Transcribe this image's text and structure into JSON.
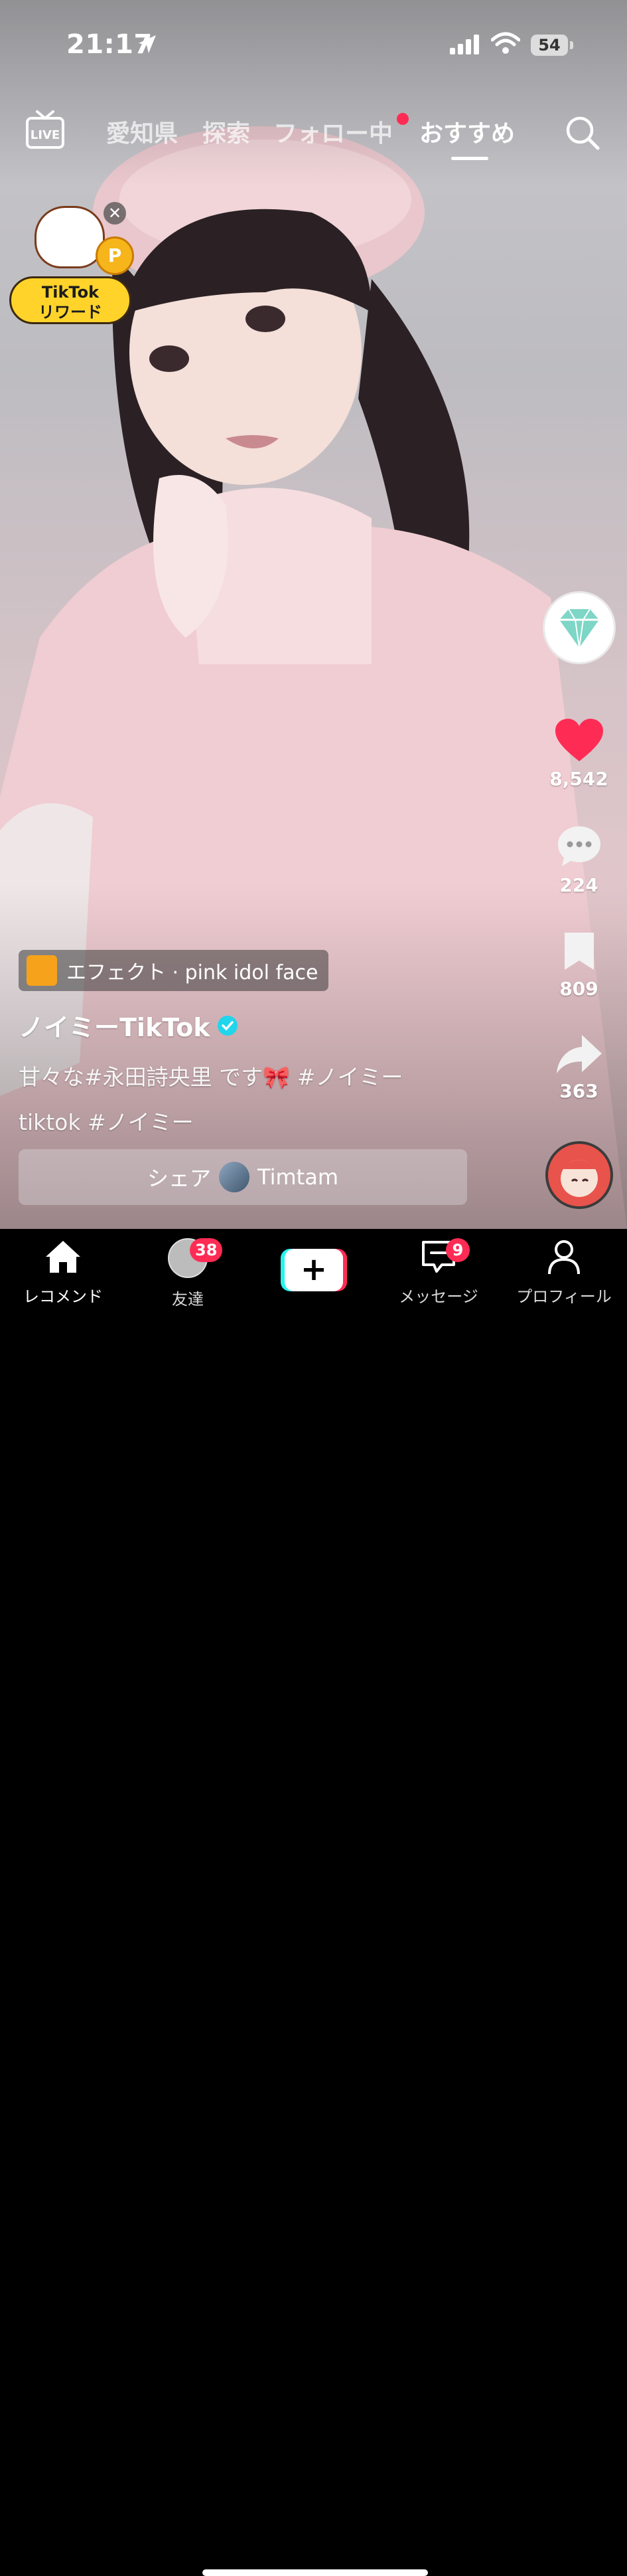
{
  "status_bar": {
    "time": "21:17",
    "battery": "54"
  },
  "top_nav": {
    "live_label": "LIVE",
    "tabs": [
      {
        "label": "愛知県",
        "active": false
      },
      {
        "label": "探索",
        "active": false
      },
      {
        "label": "フォロー中",
        "active": false,
        "notification_dot": true
      },
      {
        "label": "おすすめ",
        "active": true
      }
    ]
  },
  "rewards_widget": {
    "line1": "TikTok",
    "line2": "リワード",
    "coin_letter": "P",
    "close_glyph": "✕"
  },
  "actions": {
    "likes": "8,542",
    "comments": "224",
    "saves": "809",
    "shares": "363"
  },
  "post": {
    "effect_label": "エフェクト · pink idol face",
    "username": "ノイミーTikTok",
    "verified": true,
    "caption_line1": "甘々な#永田詩央里 です🎀 #ノイミー",
    "caption_line2": "tiktok #ノイミー",
    "share_prefix": "シェア",
    "share_user": "Timtam"
  },
  "bottom_nav": {
    "home": "レコメンド",
    "friends": "友達",
    "friends_badge": "38",
    "create_glyph": "+",
    "inbox": "メッセージ",
    "inbox_badge": "9",
    "profile": "プロフィール"
  },
  "colors": {
    "accent_red": "#fe2c55",
    "accent_cyan": "#25f4ee",
    "verified": "#20d5ec",
    "reward_yellow": "#ffd32a"
  },
  "icons": [
    "live-icon",
    "search-icon",
    "heart-icon",
    "comment-icon",
    "bookmark-icon",
    "share-arrow-icon",
    "home-icon",
    "inbox-icon",
    "profile-icon",
    "location-arrow-icon",
    "signal-icon",
    "wifi-icon"
  ]
}
